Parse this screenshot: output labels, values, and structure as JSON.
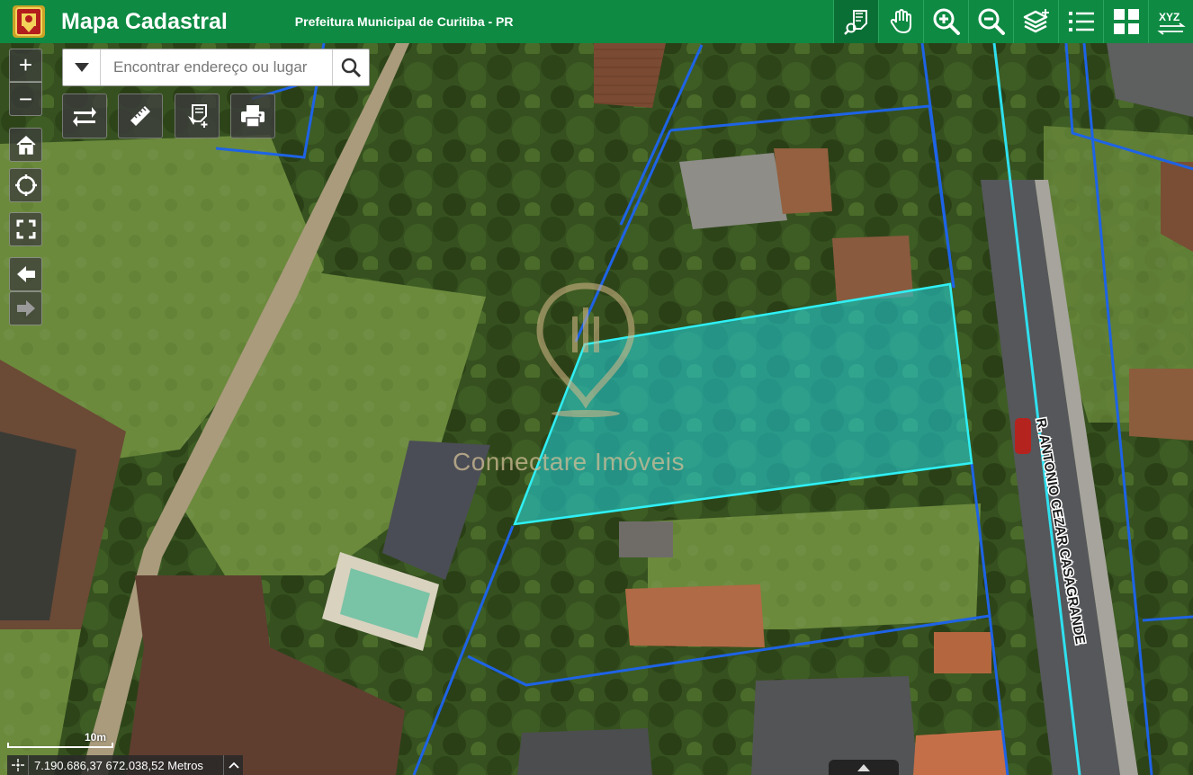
{
  "header": {
    "app_title": "Mapa Cadastral",
    "subtitle": "Prefeitura Municipal de Curitiba - PR",
    "bg_color": "#0e8a43",
    "tools": [
      {
        "name": "identify-tool-icon",
        "active": true
      },
      {
        "name": "pan-hand-icon",
        "active": false
      },
      {
        "name": "zoom-in-tool-icon",
        "active": false
      },
      {
        "name": "zoom-out-tool-icon",
        "active": false
      },
      {
        "name": "layers-icon",
        "active": false
      },
      {
        "name": "legend-list-icon",
        "active": false
      },
      {
        "name": "basemap-grid-icon",
        "active": false
      },
      {
        "name": "xyz-coordinates-icon",
        "label": "XYZ",
        "active": false
      }
    ]
  },
  "search": {
    "placeholder": "Encontrar endereço ou lugar",
    "value": ""
  },
  "map_controls": {
    "zoom_in": "+",
    "zoom_out": "−"
  },
  "action_buttons": [
    "swap-arrows-icon",
    "measure-ruler-icon",
    "identify-add-icon",
    "print-icon"
  ],
  "side_buttons": [
    "home-icon",
    "locate-icon",
    "fullscreen-icon",
    "previous-extent-arrow-icon",
    "next-extent-arrow-icon"
  ],
  "map": {
    "watermark": "Connectare Imóveis",
    "street_label": "R. ANTONIO CEZAR CASAGRANDE",
    "highlight_color": "#1fd6e0",
    "parcel_line_color": "#1e63e6"
  },
  "status": {
    "scale_label": "10m",
    "coordinates": "7.190.686,37 672.038,52 Metros"
  }
}
